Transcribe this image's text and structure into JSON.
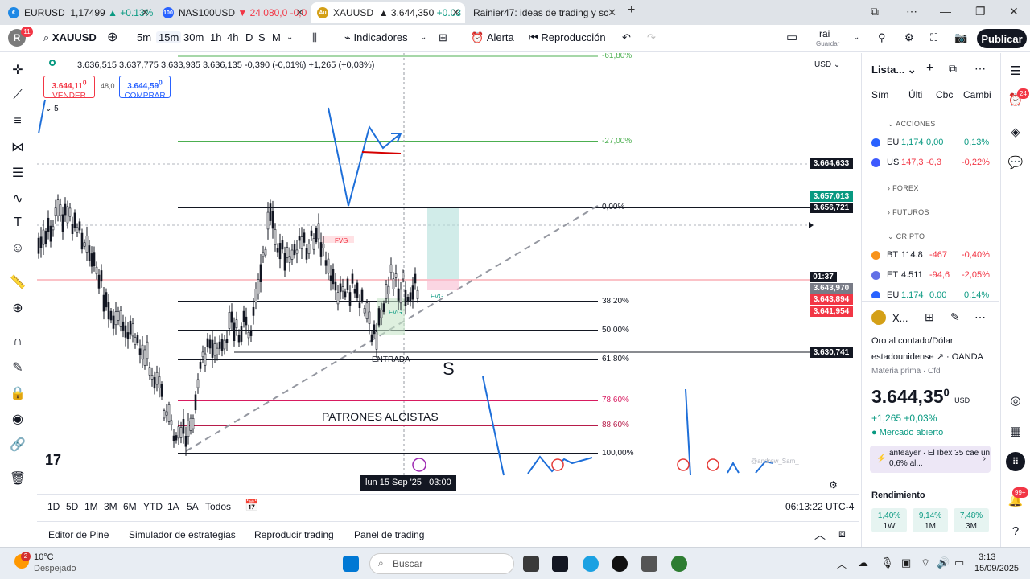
{
  "browser": {
    "tabs": [
      {
        "title": "EURUSD",
        "price": "1,17499",
        "change": "▲ +0.13%",
        "dir": "up",
        "icon": "eurusd-flag-icon"
      },
      {
        "title": "NAS100USD",
        "price": "▼ 24.080,0",
        "change": "-0,0",
        "dir": "down",
        "icon": "nas100-icon"
      },
      {
        "title": "XAUUSD",
        "price": "▲ 3.644,350",
        "change": "+0.03",
        "dir": "up",
        "icon": "gold-icon"
      },
      {
        "title": "Rainier47: ideas de trading y sc",
        "price": "",
        "change": "",
        "dir": "",
        "icon": "tradingview-icon"
      }
    ],
    "new_tab": "+"
  },
  "toolbar": {
    "avatar_letter": "R",
    "avatar_badge": "11",
    "symbol": "XAUUSD",
    "intervals": [
      "5m",
      "15m",
      "30m",
      "1h",
      "4h",
      "D",
      "S",
      "M"
    ],
    "selected_interval": "15m",
    "indicators": "Indicadores",
    "alert": "Alerta",
    "replay": "Reproducción",
    "layout_name": "rai",
    "layout_sub": "Guardar",
    "publish": "Publicar"
  },
  "chart": {
    "ohlc_legend": "3.636,515   3.637,775   3.633,935   3.636,135   -0,390 (-0,01%)   +1,265 (+0,03%)",
    "sell_price": "3.644,11",
    "sell_price_sup": "0",
    "sell_label": "VENDER",
    "spread": "48,0",
    "buy_price": "3.644,59",
    "buy_price_sup": "0",
    "buy_label": "COMPRAR",
    "indicator_count": "5",
    "currency": "USD",
    "fib_labels": [
      "-61,80%",
      "-27,00%",
      "0,00%",
      "38,20%",
      "50,00%",
      "61,80%",
      "78,60%",
      "88,60%",
      "100,00%"
    ],
    "price_tags": [
      {
        "value": "3.664,633",
        "color": "#131722"
      },
      {
        "value": "3.657,013",
        "color": "#089981"
      },
      {
        "value": "3.656,721",
        "color": "#131722"
      },
      {
        "value": "01:37",
        "color": "#131722"
      },
      {
        "value": "3.643,970",
        "color": "#787b86"
      },
      {
        "value": "3.643,894",
        "color": "#f23645"
      },
      {
        "value": "3.641,954",
        "color": "#f23645"
      },
      {
        "value": "3.630,741",
        "color": "#131722"
      }
    ],
    "fvg_label": "FVG",
    "entrada_label": "ENTRADA",
    "s_label": "S",
    "patrones_label": "PATRONES ALCISTAS",
    "crosshair_date": "lun 15 Sep '25   03:00",
    "watermark": "@andrew_Sam_"
  },
  "ranges": {
    "items": [
      "1D",
      "5D",
      "1M",
      "3M",
      "6M",
      "YTD",
      "1A",
      "5A",
      "Todos"
    ],
    "clock": "06:13:22 UTC-4"
  },
  "panels": [
    "Editor de Pine",
    "Simulador de estrategias",
    "Reproducir trading",
    "Panel de trading"
  ],
  "watchlist": {
    "title": "Lista...",
    "cols": [
      "Sím",
      "Últi",
      "Cbc",
      "Cambi"
    ],
    "sections": {
      "acciones": "ACCIONES",
      "forex": "FOREX",
      "futuros": "FUTUROS",
      "cripto": "CRIPTO"
    },
    "rows_acciones": [
      {
        "sym": "EU",
        "last": "1,174",
        "chg": "0,00",
        "pct": "0,13%",
        "dir": "pos",
        "color": "#2962ff"
      },
      {
        "sym": "US",
        "last": "147,3",
        "chg": "-0,3",
        "pct": "-0,22%",
        "dir": "neg",
        "color": "#3d5afe"
      }
    ],
    "rows_cripto": [
      {
        "sym": "BT",
        "last": "114.8",
        "chg": "-467",
        "pct": "-0,40%",
        "dir": "neg",
        "color": "#f7931a"
      },
      {
        "sym": "ET",
        "last": "4.511",
        "chg": "-94,6",
        "pct": "-2,05%",
        "dir": "neg",
        "color": "#6270e6"
      },
      {
        "sym": "EU",
        "last": "1.174",
        "chg": "0,00",
        "pct": "0,14%",
        "dir": "pos",
        "color": "#2962ff"
      }
    ]
  },
  "details": {
    "symbol": "X...",
    "name_line1": "Oro al contado/Dólar",
    "name_line2": "estadounidense",
    "exchange": "OANDA",
    "category": "Materia prima · Cfd",
    "price": "3.644,35",
    "price_sup": "0",
    "price_currency": "USD",
    "change": "+1,265  +0,03%",
    "market_status": "Mercado abierto",
    "news_time": "anteayer",
    "news_text": "El Ibex 35 cae un 0,6% al...",
    "performance_title": "Rendimiento",
    "performance": [
      {
        "value": "1,40%",
        "label": "1W"
      },
      {
        "value": "9,14%",
        "label": "1M"
      },
      {
        "value": "7,48%",
        "label": "3M"
      }
    ]
  },
  "rightbar": {
    "alerts_badge": "24",
    "notifications_badge": "99+"
  },
  "taskbar": {
    "weather_badge": "2",
    "temperature": "10°C",
    "weather": "Despejado",
    "search": "Buscar",
    "time": "3:13",
    "date": "15/09/2025"
  }
}
